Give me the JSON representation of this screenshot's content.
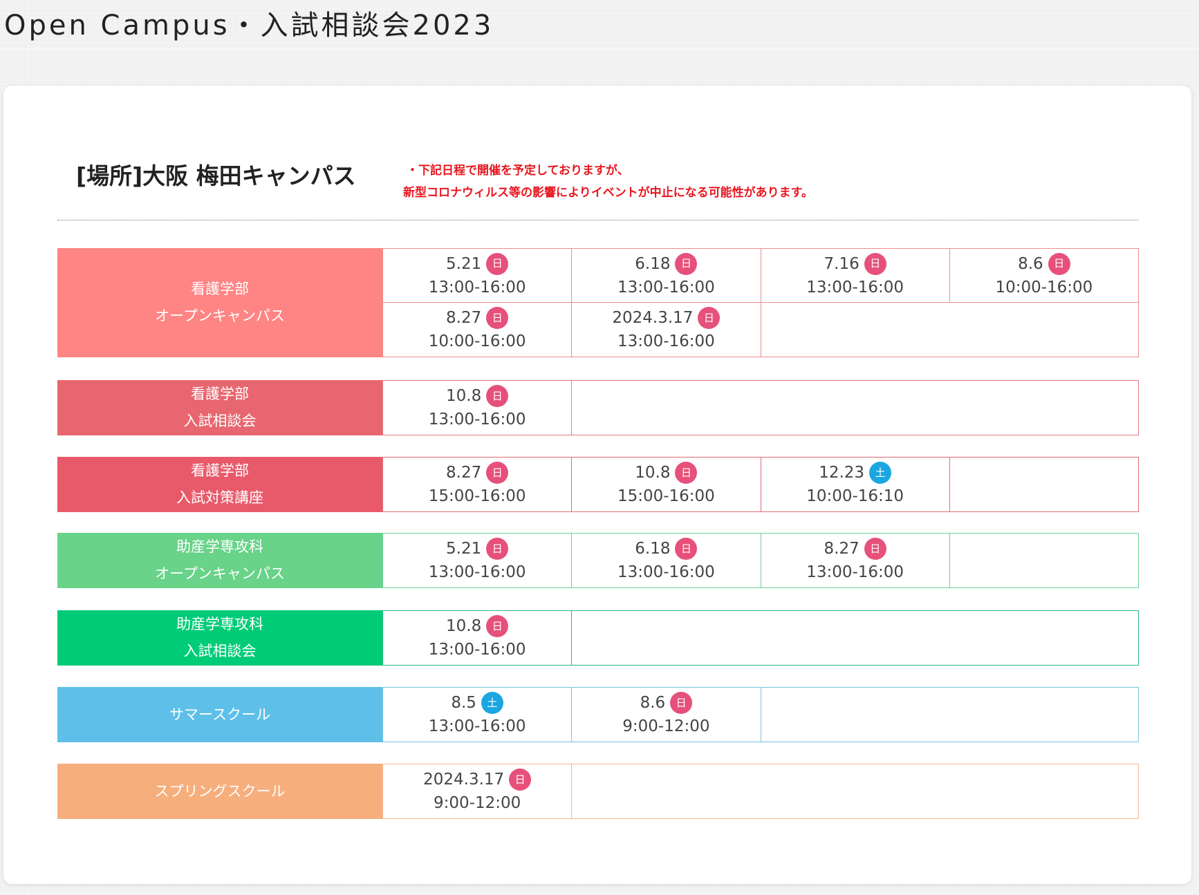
{
  "page": {
    "title": "Open Campus・入試相談会2023"
  },
  "venue": {
    "heading": "[場所]大阪 梅田キャンパス",
    "notice_line1": "・下記日程で開催を予定しておりますが、",
    "notice_line2": "新型コロナウィルス等の影響によりイベントが中止になる可能性があります。"
  },
  "colors": {
    "nursing_open": "#ff8484",
    "nursing_consult": "#e8666f",
    "nursing_prep": "#e85a6a",
    "midwife_open": "#68d389",
    "midwife_consult": "#00cc77",
    "summer": "#5ec0e8",
    "spring": "#f7ae7d",
    "sunday_badge": "#e6507a",
    "saturday_badge": "#1aa6e0"
  },
  "schedules": [
    {
      "label_line1": "看護学部",
      "label_line2": "オープンキャンパス",
      "sessions": [
        {
          "date": "5.21",
          "day": "日",
          "time": "13:00-16:00"
        },
        {
          "date": "6.18",
          "day": "日",
          "time": "13:00-16:00"
        },
        {
          "date": "7.16",
          "day": "日",
          "time": "13:00-16:00"
        },
        {
          "date": "8.6",
          "day": "日",
          "time": "10:00-16:00"
        },
        {
          "date": "8.27",
          "day": "日",
          "time": "10:00-16:00"
        },
        {
          "date": "2024.3.17",
          "day": "日",
          "time": "13:00-16:00"
        }
      ]
    },
    {
      "label_line1": "看護学部",
      "label_line2": "入試相談会",
      "sessions": [
        {
          "date": "10.8",
          "day": "日",
          "time": "13:00-16:00"
        }
      ]
    },
    {
      "label_line1": "看護学部",
      "label_line2": "入試対策講座",
      "sessions": [
        {
          "date": "8.27",
          "day": "日",
          "time": "15:00-16:00"
        },
        {
          "date": "10.8",
          "day": "日",
          "time": "15:00-16:00"
        },
        {
          "date": "12.23",
          "day": "土",
          "time": "10:00-16:10"
        }
      ]
    },
    {
      "label_line1": "助産学専攻科",
      "label_line2": "オープンキャンパス",
      "sessions": [
        {
          "date": "5.21",
          "day": "日",
          "time": "13:00-16:00"
        },
        {
          "date": "6.18",
          "day": "日",
          "time": "13:00-16:00"
        },
        {
          "date": "8.27",
          "day": "日",
          "time": "13:00-16:00"
        }
      ]
    },
    {
      "label_line1": "助産学専攻科",
      "label_line2": "入試相談会",
      "sessions": [
        {
          "date": "10.8",
          "day": "日",
          "time": "13:00-16:00"
        }
      ]
    },
    {
      "label_line1": "サマースクール",
      "label_line2": "",
      "sessions": [
        {
          "date": "8.5",
          "day": "土",
          "time": "13:00-16:00"
        },
        {
          "date": "8.6",
          "day": "日",
          "time": "9:00-12:00"
        }
      ]
    },
    {
      "label_line1": "スプリングスクール",
      "label_line2": "",
      "sessions": [
        {
          "date": "2024.3.17",
          "day": "日",
          "time": "9:00-12:00"
        }
      ]
    }
  ]
}
